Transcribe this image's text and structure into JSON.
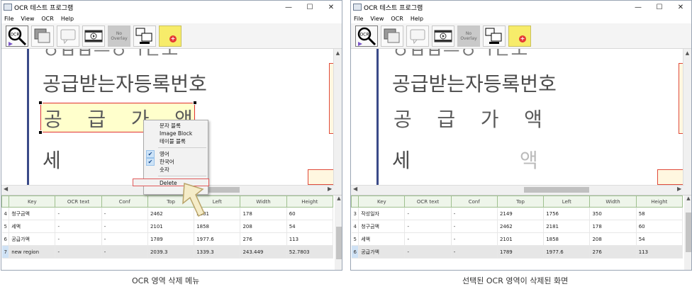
{
  "windows": [
    {
      "title": "OCR 테스트 프로그램",
      "menu": [
        "File",
        "View",
        "OCR",
        "Help"
      ],
      "toolbar": {
        "no_overlay": "No Overlay",
        "ocr_label": "OCR"
      },
      "document_lines": [
        "공급받는자등록번호",
        "공  급  가  액",
        "세"
      ],
      "columns": [
        "Key",
        "OCR text",
        "Conf",
        "Top",
        "Left",
        "Width",
        "Height"
      ],
      "rows": [
        {
          "idx": "4",
          "key": "청구금액",
          "ocr": "-",
          "conf": "-",
          "top": "2462",
          "left": "2181",
          "width": "178",
          "height": "60"
        },
        {
          "idx": "5",
          "key": "세액",
          "ocr": "-",
          "conf": "-",
          "top": "2101",
          "left": "1858",
          "width": "208",
          "height": "54"
        },
        {
          "idx": "6",
          "key": "공급가액",
          "ocr": "-",
          "conf": "-",
          "top": "1789",
          "left": "1977.6",
          "width": "276",
          "height": "113"
        },
        {
          "idx": "7",
          "key": "new region",
          "ocr": "-",
          "conf": "-",
          "top": "2039.3",
          "left": "1339.3",
          "width": "243.449",
          "height": "52.7803"
        }
      ],
      "context_menu": [
        "문자 블록",
        "Image Block",
        "테이블 블록",
        "영어",
        "한국어",
        "숫자",
        "Delete"
      ]
    },
    {
      "title": "OCR 테스트 프로그램",
      "menu": [
        "File",
        "View",
        "OCR",
        "Help"
      ],
      "toolbar": {
        "no_overlay": "No Overlay",
        "ocr_label": "OCR"
      },
      "document_lines": [
        "공급받는자등록번호",
        "공  급  가  액",
        "세",
        "액"
      ],
      "columns": [
        "Key",
        "OCR text",
        "Conf",
        "Top",
        "Left",
        "Width",
        "Height"
      ],
      "rows": [
        {
          "idx": "3",
          "key": "작성일자",
          "ocr": "-",
          "conf": "-",
          "top": "2149",
          "left": "1756",
          "width": "350",
          "height": "58"
        },
        {
          "idx": "4",
          "key": "청구금액",
          "ocr": "-",
          "conf": "-",
          "top": "2462",
          "left": "2181",
          "width": "178",
          "height": "60"
        },
        {
          "idx": "5",
          "key": "세액",
          "ocr": "-",
          "conf": "-",
          "top": "2101",
          "left": "1858",
          "width": "208",
          "height": "54"
        },
        {
          "idx": "6",
          "key": "공급가액",
          "ocr": "-",
          "conf": "-",
          "top": "1789",
          "left": "1977.6",
          "width": "276",
          "height": "113"
        }
      ]
    }
  ],
  "captions": [
    "OCR 영역 삭제 메뉴",
    "선택된 OCR 영역이 삭제된 화면"
  ],
  "colors": {
    "selection_box": "#e03030",
    "grid_header": "#eef5ea",
    "highlight_yellow": "#f7ec6a"
  }
}
